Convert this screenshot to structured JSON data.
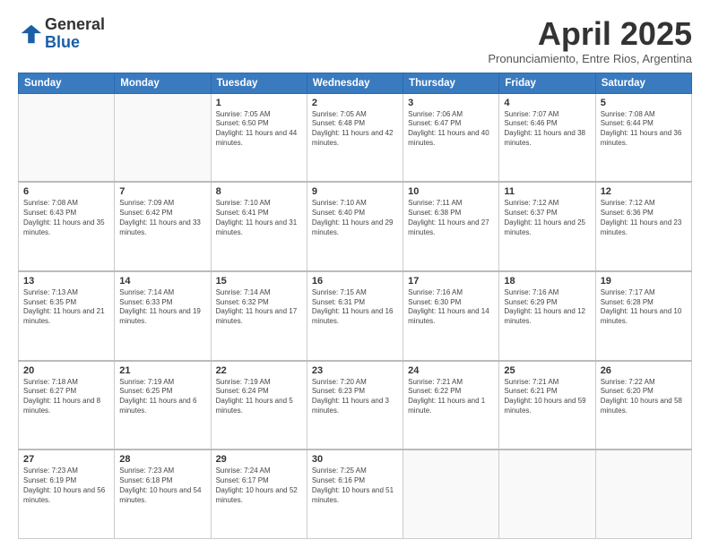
{
  "header": {
    "logo_line1": "General",
    "logo_line2": "Blue",
    "title": "April 2025",
    "subtitle": "Pronunciamiento, Entre Rios, Argentina"
  },
  "calendar": {
    "days_of_week": [
      "Sunday",
      "Monday",
      "Tuesday",
      "Wednesday",
      "Thursday",
      "Friday",
      "Saturday"
    ],
    "weeks": [
      [
        {
          "day": "",
          "info": ""
        },
        {
          "day": "",
          "info": ""
        },
        {
          "day": "1",
          "info": "Sunrise: 7:05 AM\nSunset: 6:50 PM\nDaylight: 11 hours and 44 minutes."
        },
        {
          "day": "2",
          "info": "Sunrise: 7:05 AM\nSunset: 6:48 PM\nDaylight: 11 hours and 42 minutes."
        },
        {
          "day": "3",
          "info": "Sunrise: 7:06 AM\nSunset: 6:47 PM\nDaylight: 11 hours and 40 minutes."
        },
        {
          "day": "4",
          "info": "Sunrise: 7:07 AM\nSunset: 6:46 PM\nDaylight: 11 hours and 38 minutes."
        },
        {
          "day": "5",
          "info": "Sunrise: 7:08 AM\nSunset: 6:44 PM\nDaylight: 11 hours and 36 minutes."
        }
      ],
      [
        {
          "day": "6",
          "info": "Sunrise: 7:08 AM\nSunset: 6:43 PM\nDaylight: 11 hours and 35 minutes."
        },
        {
          "day": "7",
          "info": "Sunrise: 7:09 AM\nSunset: 6:42 PM\nDaylight: 11 hours and 33 minutes."
        },
        {
          "day": "8",
          "info": "Sunrise: 7:10 AM\nSunset: 6:41 PM\nDaylight: 11 hours and 31 minutes."
        },
        {
          "day": "9",
          "info": "Sunrise: 7:10 AM\nSunset: 6:40 PM\nDaylight: 11 hours and 29 minutes."
        },
        {
          "day": "10",
          "info": "Sunrise: 7:11 AM\nSunset: 6:38 PM\nDaylight: 11 hours and 27 minutes."
        },
        {
          "day": "11",
          "info": "Sunrise: 7:12 AM\nSunset: 6:37 PM\nDaylight: 11 hours and 25 minutes."
        },
        {
          "day": "12",
          "info": "Sunrise: 7:12 AM\nSunset: 6:36 PM\nDaylight: 11 hours and 23 minutes."
        }
      ],
      [
        {
          "day": "13",
          "info": "Sunrise: 7:13 AM\nSunset: 6:35 PM\nDaylight: 11 hours and 21 minutes."
        },
        {
          "day": "14",
          "info": "Sunrise: 7:14 AM\nSunset: 6:33 PM\nDaylight: 11 hours and 19 minutes."
        },
        {
          "day": "15",
          "info": "Sunrise: 7:14 AM\nSunset: 6:32 PM\nDaylight: 11 hours and 17 minutes."
        },
        {
          "day": "16",
          "info": "Sunrise: 7:15 AM\nSunset: 6:31 PM\nDaylight: 11 hours and 16 minutes."
        },
        {
          "day": "17",
          "info": "Sunrise: 7:16 AM\nSunset: 6:30 PM\nDaylight: 11 hours and 14 minutes."
        },
        {
          "day": "18",
          "info": "Sunrise: 7:16 AM\nSunset: 6:29 PM\nDaylight: 11 hours and 12 minutes."
        },
        {
          "day": "19",
          "info": "Sunrise: 7:17 AM\nSunset: 6:28 PM\nDaylight: 11 hours and 10 minutes."
        }
      ],
      [
        {
          "day": "20",
          "info": "Sunrise: 7:18 AM\nSunset: 6:27 PM\nDaylight: 11 hours and 8 minutes."
        },
        {
          "day": "21",
          "info": "Sunrise: 7:19 AM\nSunset: 6:25 PM\nDaylight: 11 hours and 6 minutes."
        },
        {
          "day": "22",
          "info": "Sunrise: 7:19 AM\nSunset: 6:24 PM\nDaylight: 11 hours and 5 minutes."
        },
        {
          "day": "23",
          "info": "Sunrise: 7:20 AM\nSunset: 6:23 PM\nDaylight: 11 hours and 3 minutes."
        },
        {
          "day": "24",
          "info": "Sunrise: 7:21 AM\nSunset: 6:22 PM\nDaylight: 11 hours and 1 minute."
        },
        {
          "day": "25",
          "info": "Sunrise: 7:21 AM\nSunset: 6:21 PM\nDaylight: 10 hours and 59 minutes."
        },
        {
          "day": "26",
          "info": "Sunrise: 7:22 AM\nSunset: 6:20 PM\nDaylight: 10 hours and 58 minutes."
        }
      ],
      [
        {
          "day": "27",
          "info": "Sunrise: 7:23 AM\nSunset: 6:19 PM\nDaylight: 10 hours and 56 minutes."
        },
        {
          "day": "28",
          "info": "Sunrise: 7:23 AM\nSunset: 6:18 PM\nDaylight: 10 hours and 54 minutes."
        },
        {
          "day": "29",
          "info": "Sunrise: 7:24 AM\nSunset: 6:17 PM\nDaylight: 10 hours and 52 minutes."
        },
        {
          "day": "30",
          "info": "Sunrise: 7:25 AM\nSunset: 6:16 PM\nDaylight: 10 hours and 51 minutes."
        },
        {
          "day": "",
          "info": ""
        },
        {
          "day": "",
          "info": ""
        },
        {
          "day": "",
          "info": ""
        }
      ]
    ]
  }
}
